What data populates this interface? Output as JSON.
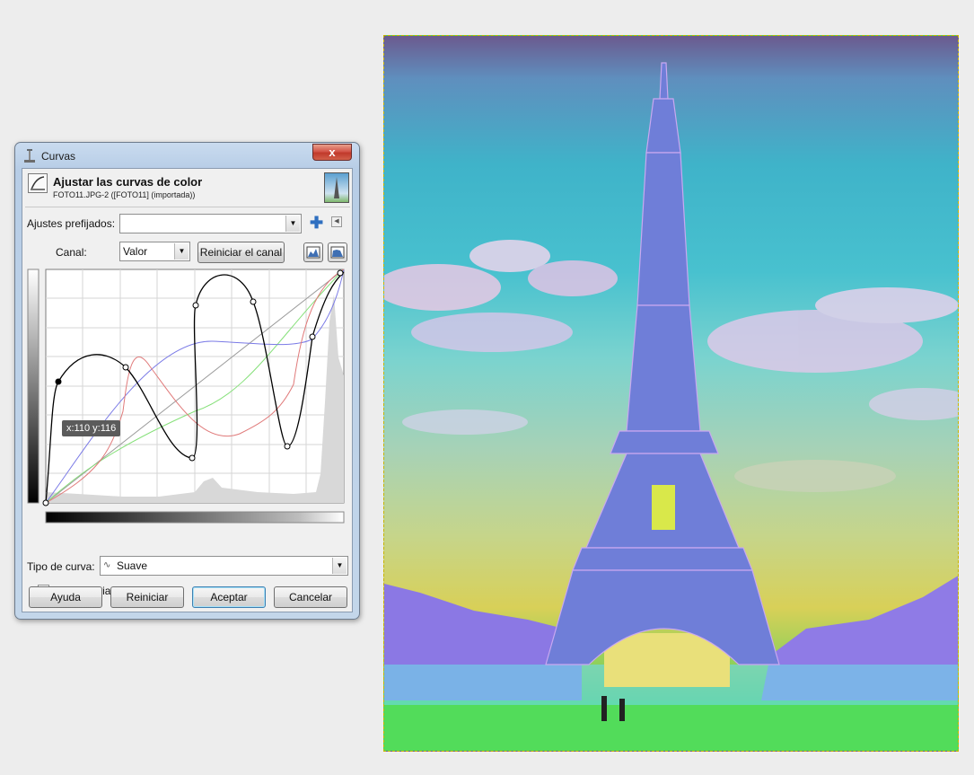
{
  "dialog": {
    "title": "Curvas",
    "close_label": "x",
    "header_title": "Ajustar las curvas de color",
    "header_subtitle": "FOTO11.JPG-2 ([FOTO11] (importada))",
    "presets_label": "Ajustes prefijados:",
    "presets_value": "",
    "channel_label": "Canal:",
    "channel_value": "Valor",
    "reset_channel_label": "Reiniciar el canal",
    "curve_tooltip": "x:110 y:116",
    "curve_type_label": "Tipo de curva:",
    "curve_type_value": "Suave",
    "preview_label": "Vista previa",
    "preview_checked": true,
    "buttons": {
      "help": "Ayuda",
      "reset": "Reiniciar",
      "ok": "Aceptar",
      "cancel": "Cancelar"
    }
  },
  "icons": {
    "add_preset": "plus-icon",
    "preset_menu": "triangle-left-icon",
    "histogram_linear": "histogram-linear-icon",
    "histogram_log": "histogram-log-icon",
    "curve_type": "smooth-curve-icon"
  },
  "colors": {
    "dialog_frame": "#c3d6ea",
    "close_button": "#c0392b",
    "curve_value": "#000000",
    "curve_red": "#e07a7a",
    "curve_green": "#86e07a",
    "curve_blue": "#7a7ae6",
    "selection_border": "#c9b400"
  }
}
